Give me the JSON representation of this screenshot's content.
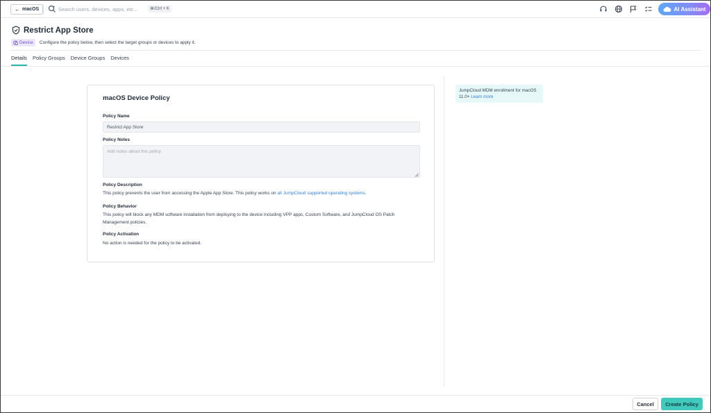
{
  "topbar": {
    "back_label": "macOS",
    "search_placeholder": "Search users, devices, apps, etc...",
    "shortcut": "⌘/Ctrl + K",
    "ai_label": "AI Assistant"
  },
  "header": {
    "title": "Restrict App Store",
    "badge": "Device",
    "subtitle": "Configure the policy below, then select the target groups or devices to apply it."
  },
  "tabs": [
    {
      "label": "Details",
      "active": true
    },
    {
      "label": "Policy Groups",
      "active": false
    },
    {
      "label": "Device Groups",
      "active": false
    },
    {
      "label": "Devices",
      "active": false
    }
  ],
  "card": {
    "title": "macOS Device Policy",
    "policy_name_label": "Policy Name",
    "policy_name_value": "Restrict App Store",
    "policy_notes_label": "Policy Notes",
    "policy_notes_placeholder": "Add notes about this policy",
    "description_label": "Policy Description",
    "description_text": "This policy prevents the user from accessing the Apple App Store. This policy works on ",
    "description_link": "all JumpCloud supported operating systems",
    "description_end": ".",
    "behavior_label": "Policy Behavior",
    "behavior_text": "This policy will block any MDM software installation from deploying to the device including VPP apps, Custom Software, and JumpCloud OS Patch Management policies.",
    "activation_label": "Policy Activation",
    "activation_text": "No action is needed for the policy to be activated."
  },
  "info": {
    "text": "JumpCloud MDM enrollment for macOS 11.0+",
    "link": "Learn more"
  },
  "footer": {
    "cancel_label": "Cancel",
    "create_label": "Create Policy"
  },
  "colors": {
    "accent": "#41c9be",
    "link": "#2f7fd9",
    "badge_bg": "#ece7fb"
  }
}
